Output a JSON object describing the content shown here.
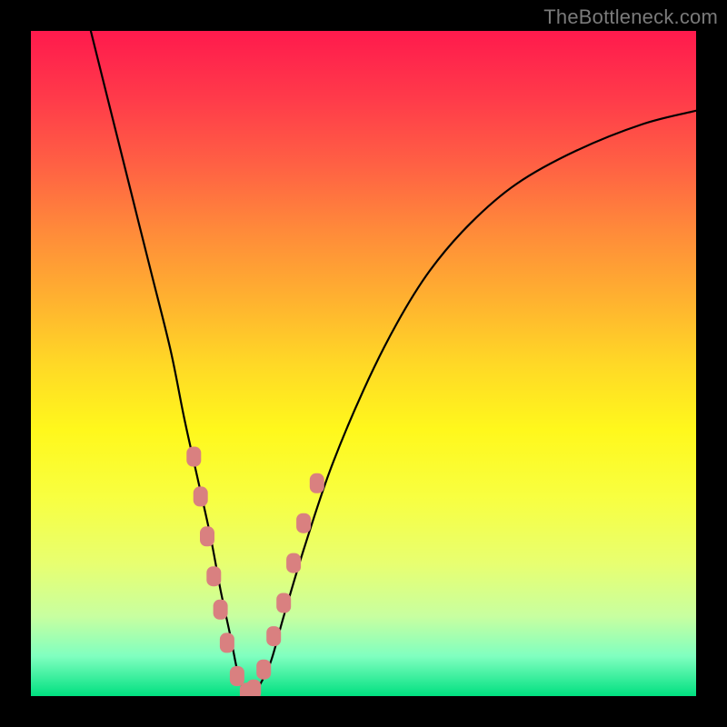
{
  "watermark": "TheBottleneck.com",
  "chart_data": {
    "type": "line",
    "title": "",
    "xlabel": "",
    "ylabel": "",
    "xlim": [
      0,
      100
    ],
    "ylim": [
      0,
      100
    ],
    "series": [
      {
        "name": "bottleneck-curve",
        "x": [
          9,
          12,
          15,
          18,
          21,
          23,
          25,
          27,
          28.5,
          30,
          31,
          32,
          33,
          34,
          36,
          38,
          41,
          45,
          50,
          55,
          60,
          66,
          73,
          82,
          92,
          100
        ],
        "y": [
          100,
          88,
          76,
          64,
          52,
          42,
          33,
          24,
          16,
          9,
          4,
          1,
          0,
          1,
          5,
          12,
          22,
          34,
          46,
          56,
          64,
          71,
          77,
          82,
          86,
          88
        ]
      }
    ],
    "markers": {
      "name": "highlight-points",
      "x": [
        24.5,
        25.5,
        26.5,
        27.5,
        28.5,
        29.5,
        31,
        32.5,
        33.5,
        35,
        36.5,
        38,
        39.5,
        41,
        43
      ],
      "y": [
        36,
        30,
        24,
        18,
        13,
        8,
        3,
        0.5,
        1,
        4,
        9,
        14,
        20,
        26,
        32
      ]
    },
    "gradient_stops": [
      {
        "pos": 0,
        "color": "#ff1a4d"
      },
      {
        "pos": 50,
        "color": "#fff81c"
      },
      {
        "pos": 100,
        "color": "#00e080"
      }
    ]
  }
}
